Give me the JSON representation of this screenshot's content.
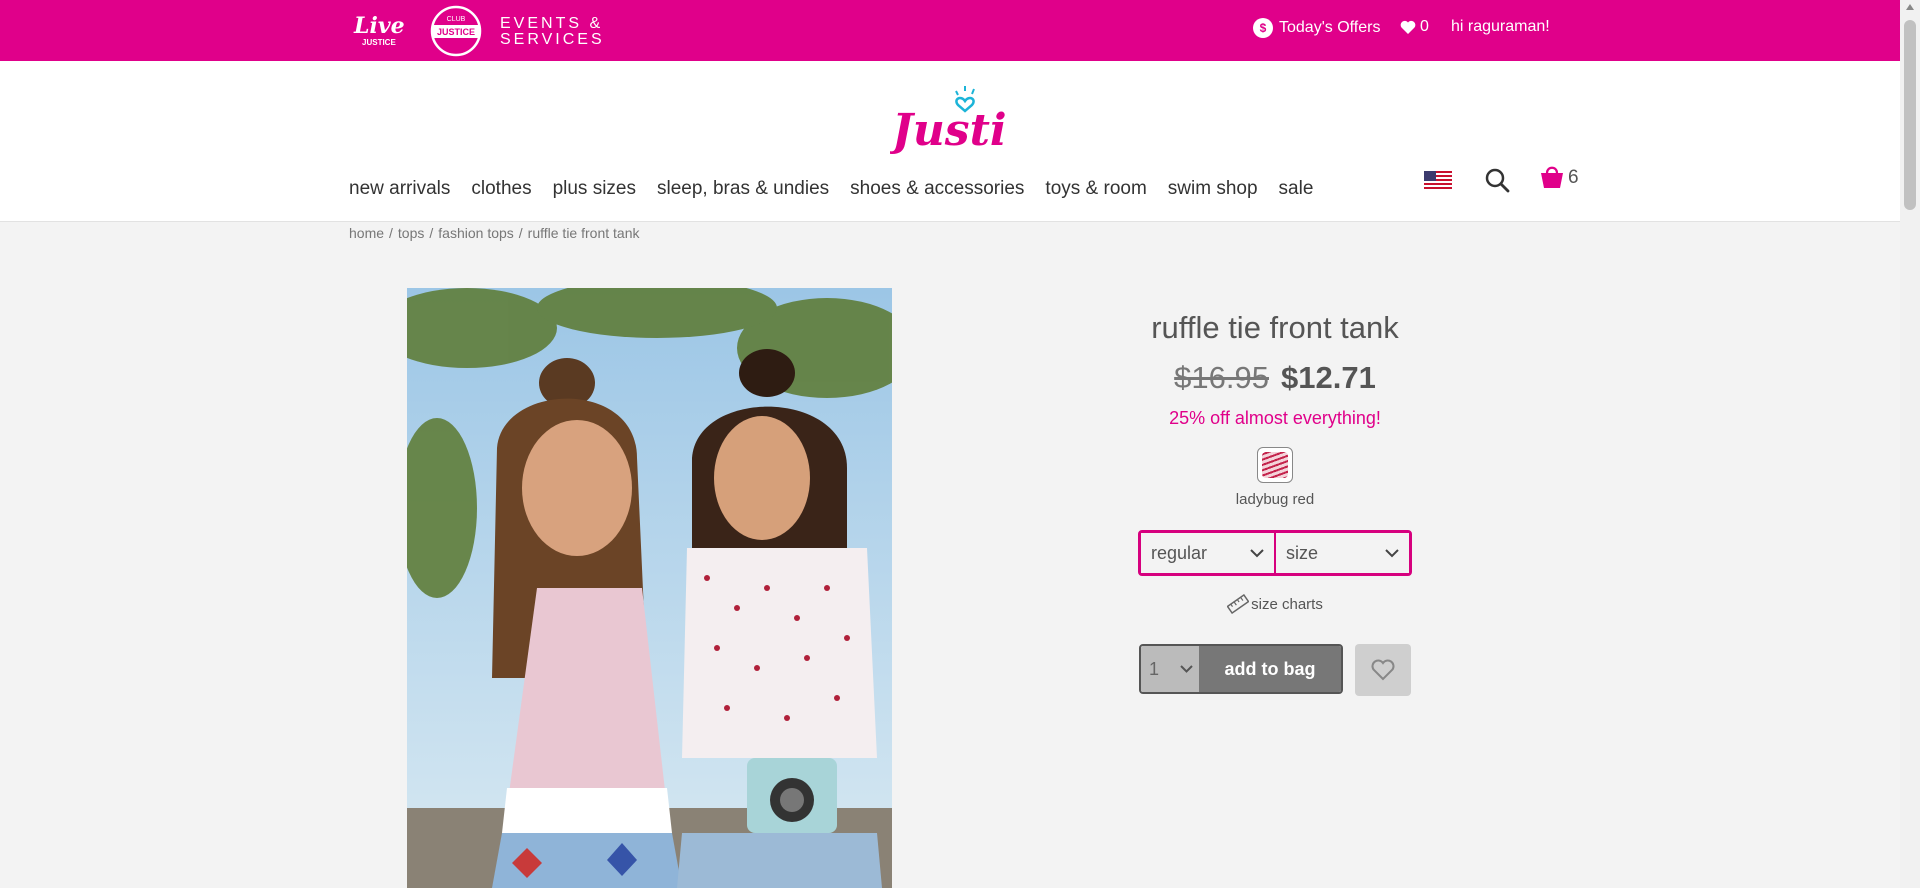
{
  "topbar": {
    "events_line1": "EVENTS &",
    "events_line2": "SERVICES",
    "offers_label": "Today's Offers",
    "offers_icon": "dollar-icon",
    "wishlist_count": "0",
    "greeting": "hi raguraman!",
    "bg_color": "#e0008a"
  },
  "nav": {
    "items": [
      "new arrivals",
      "clothes",
      "plus sizes",
      "sleep, bras & undies",
      "shoes & accessories",
      "toys & room",
      "swim shop",
      "sale"
    ],
    "cart_count": "6"
  },
  "breadcrumb": [
    "home",
    "tops",
    "fashion tops",
    "ruffle tie front tank"
  ],
  "product": {
    "title": "ruffle tie front tank",
    "old_price": "$16.95",
    "new_price": "$12.71",
    "promo": "25% off almost everything!",
    "color_name": "ladybug red",
    "fit_select": "regular",
    "size_select": "size",
    "size_charts": "size charts",
    "quantity": "1",
    "add_to_bag": "add to bag"
  },
  "colors": {
    "accent": "#e0008a",
    "button": "#777777"
  }
}
